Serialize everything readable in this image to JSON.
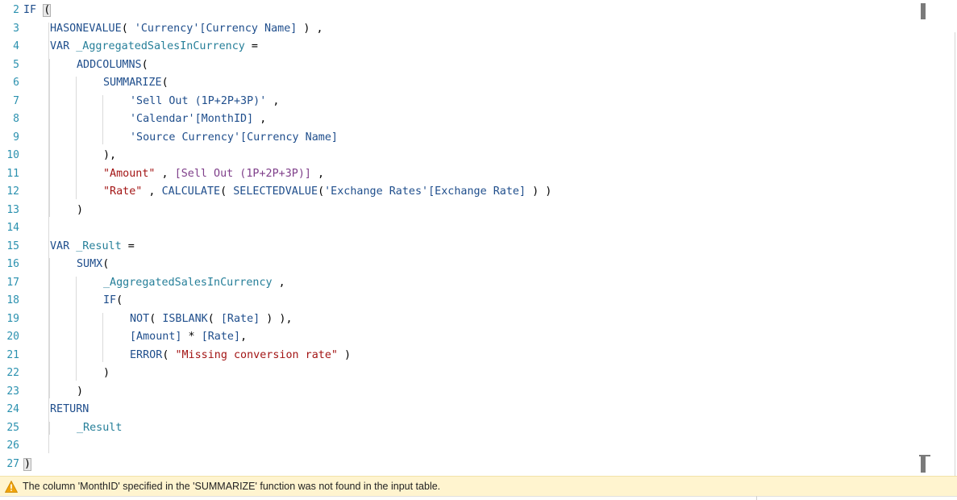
{
  "editor": {
    "lines": [
      {
        "num": "2",
        "indent": 0,
        "tokens": [
          [
            "kw",
            "IF "
          ],
          [
            "paren",
            "("
          ]
        ]
      },
      {
        "num": "3",
        "indent": 1,
        "tokens": [
          [
            "kw",
            "HASONEVALUE"
          ],
          [
            "",
            "( "
          ],
          [
            "tbl",
            "'Currency'[Currency Name]"
          ],
          [
            "",
            " ) ,"
          ]
        ]
      },
      {
        "num": "4",
        "indent": 1,
        "tokens": [
          [
            "kw",
            "VAR "
          ],
          [
            "var",
            "_AggregatedSalesInCurrency"
          ],
          [
            "",
            " ="
          ]
        ]
      },
      {
        "num": "5",
        "indent": 2,
        "tokens": [
          [
            "kw",
            "ADDCOLUMNS"
          ],
          [
            "",
            "("
          ]
        ]
      },
      {
        "num": "6",
        "indent": 3,
        "tokens": [
          [
            "kw",
            "SUMMARIZE"
          ],
          [
            "",
            "("
          ]
        ]
      },
      {
        "num": "7",
        "indent": 4,
        "tokens": [
          [
            "tbl",
            "'Sell Out (1P+2P+3P)'"
          ],
          [
            "",
            " ,"
          ]
        ]
      },
      {
        "num": "8",
        "indent": 4,
        "tokens": [
          [
            "tbl",
            "'Calendar'[MonthID]"
          ],
          [
            "",
            " ,"
          ]
        ]
      },
      {
        "num": "9",
        "indent": 4,
        "tokens": [
          [
            "tbl",
            "'Source Currency'[Currency Name]"
          ]
        ]
      },
      {
        "num": "10",
        "indent": 3,
        "tokens": [
          [
            "",
            "),"
          ]
        ]
      },
      {
        "num": "11",
        "indent": 3,
        "tokens": [
          [
            "str",
            "\"Amount\""
          ],
          [
            "",
            " , "
          ],
          [
            "meas",
            "[Sell Out (1P+2P+3P)]"
          ],
          [
            "",
            " ,"
          ]
        ]
      },
      {
        "num": "12",
        "indent": 3,
        "tokens": [
          [
            "str",
            "\"Rate\""
          ],
          [
            "",
            " , "
          ],
          [
            "kw",
            "CALCULATE"
          ],
          [
            "",
            "( "
          ],
          [
            "kw",
            "SELECTEDVALUE"
          ],
          [
            "",
            "("
          ],
          [
            "tbl",
            "'Exchange Rates'[Exchange Rate]"
          ],
          [
            "",
            " ) )"
          ]
        ]
      },
      {
        "num": "13",
        "indent": 2,
        "tokens": [
          [
            "",
            ")"
          ]
        ]
      },
      {
        "num": "14",
        "indent": 0,
        "tokens": []
      },
      {
        "num": "15",
        "indent": 1,
        "tokens": [
          [
            "kw",
            "VAR "
          ],
          [
            "var",
            "_Result"
          ],
          [
            "",
            " ="
          ]
        ]
      },
      {
        "num": "16",
        "indent": 2,
        "tokens": [
          [
            "kw",
            "SUMX"
          ],
          [
            "",
            "("
          ]
        ]
      },
      {
        "num": "17",
        "indent": 3,
        "tokens": [
          [
            "var",
            "_AggregatedSalesInCurrency"
          ],
          [
            "",
            " ,"
          ]
        ]
      },
      {
        "num": "18",
        "indent": 3,
        "tokens": [
          [
            "kw",
            "IF"
          ],
          [
            "",
            "("
          ]
        ]
      },
      {
        "num": "19",
        "indent": 4,
        "tokens": [
          [
            "kw",
            "NOT"
          ],
          [
            "",
            "( "
          ],
          [
            "kw",
            "ISBLANK"
          ],
          [
            "",
            "( "
          ],
          [
            "tbl",
            "[Rate]"
          ],
          [
            "",
            " ) ),"
          ]
        ]
      },
      {
        "num": "20",
        "indent": 4,
        "tokens": [
          [
            "tbl",
            "[Amount]"
          ],
          [
            "",
            " * "
          ],
          [
            "tbl",
            "[Rate]"
          ],
          [
            "",
            ","
          ]
        ]
      },
      {
        "num": "21",
        "indent": 4,
        "tokens": [
          [
            "kw",
            "ERROR"
          ],
          [
            "",
            "( "
          ],
          [
            "str",
            "\"Missing conversion rate\""
          ],
          [
            "",
            " )"
          ]
        ]
      },
      {
        "num": "22",
        "indent": 3,
        "tokens": [
          [
            "",
            ")"
          ]
        ]
      },
      {
        "num": "23",
        "indent": 2,
        "tokens": [
          [
            "",
            ")"
          ]
        ]
      },
      {
        "num": "24",
        "indent": 1,
        "tokens": [
          [
            "kw",
            "RETURN"
          ]
        ]
      },
      {
        "num": "25",
        "indent": 2,
        "tokens": [
          [
            "var",
            "_Result"
          ]
        ]
      },
      {
        "num": "26",
        "indent": 0,
        "tokens": []
      },
      {
        "num": "27",
        "indent": 0,
        "tokens": [
          [
            "paren",
            ")"
          ]
        ]
      }
    ]
  },
  "status": {
    "icon": "warning-icon",
    "message": "The column 'MonthID' specified in the 'SUMMARIZE' function was not found in the input table."
  },
  "colors": {
    "line_numbers": "#2b91af",
    "keyword": "#1f4e8c",
    "string": "#a31515",
    "variable": "#267f99",
    "measure": "#7f3f8a",
    "status_background": "#fff4cf"
  }
}
